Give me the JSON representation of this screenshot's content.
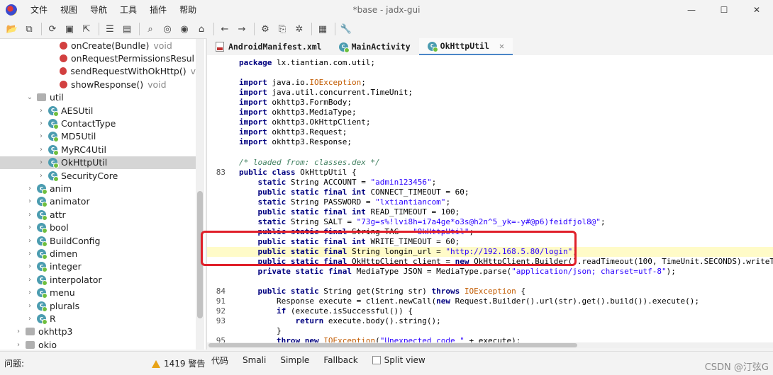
{
  "window": {
    "title": "*base - jadx-gui",
    "minimize": "—",
    "maximize": "☐",
    "close": "✕"
  },
  "menu": [
    "文件",
    "视图",
    "导航",
    "工具",
    "插件",
    "帮助"
  ],
  "toolbar_icons": [
    "open-icon",
    "add-files-icon",
    "sync-icon",
    "save-icon",
    "export-icon",
    "flatten-icon",
    "package-icon",
    "search-icon",
    "find-class-icon",
    "find-usage-icon",
    "home-icon",
    "back-icon",
    "forward-icon",
    "deobfuscation-icon",
    "decompile-icon",
    "debug-icon",
    "log-icon",
    "settings-icon"
  ],
  "tree": {
    "rows": [
      {
        "kind": "method",
        "indent": 84,
        "label": "onCreate(Bundle)",
        "type": "void"
      },
      {
        "kind": "method",
        "indent": 84,
        "label": "onRequestPermissionsResul",
        "type": ""
      },
      {
        "kind": "method",
        "indent": 84,
        "label": "sendRequestWithOkHttp()",
        "type": "v"
      },
      {
        "kind": "method",
        "indent": 84,
        "label": "showResponse()",
        "type": "void"
      },
      {
        "kind": "package",
        "indent": 36,
        "label": "util",
        "twisty": "⌄"
      },
      {
        "kind": "class",
        "indent": 52,
        "label": "AESUtil",
        "twisty": "›"
      },
      {
        "kind": "class",
        "indent": 52,
        "label": "ContactType",
        "twisty": "›"
      },
      {
        "kind": "class",
        "indent": 52,
        "label": "MD5Util",
        "twisty": "›"
      },
      {
        "kind": "class",
        "indent": 52,
        "label": "MyRC4Util",
        "twisty": "›"
      },
      {
        "kind": "class",
        "indent": 52,
        "label": "OkHttpUtil",
        "twisty": "›",
        "selected": true
      },
      {
        "kind": "class",
        "indent": 52,
        "label": "SecurityCore",
        "twisty": "›"
      },
      {
        "kind": "class",
        "indent": 36,
        "label": "anim",
        "twisty": "›"
      },
      {
        "kind": "class",
        "indent": 36,
        "label": "animator",
        "twisty": "›"
      },
      {
        "kind": "class",
        "indent": 36,
        "label": "attr",
        "twisty": "›"
      },
      {
        "kind": "class",
        "indent": 36,
        "label": "bool",
        "twisty": "›"
      },
      {
        "kind": "class",
        "indent": 36,
        "label": "BuildConfig",
        "twisty": "›"
      },
      {
        "kind": "class",
        "indent": 36,
        "label": "dimen",
        "twisty": "›"
      },
      {
        "kind": "class",
        "indent": 36,
        "label": "integer",
        "twisty": "›"
      },
      {
        "kind": "class",
        "indent": 36,
        "label": "interpolator",
        "twisty": "›"
      },
      {
        "kind": "class",
        "indent": 36,
        "label": "menu",
        "twisty": "›"
      },
      {
        "kind": "class",
        "indent": 36,
        "label": "plurals",
        "twisty": "›"
      },
      {
        "kind": "class",
        "indent": 36,
        "label": "R",
        "twisty": "›"
      },
      {
        "kind": "package",
        "indent": 20,
        "label": "okhttp3",
        "twisty": "›"
      },
      {
        "kind": "package",
        "indent": 20,
        "label": "okio",
        "twisty": "›"
      }
    ]
  },
  "tabs": [
    {
      "label": "AndroidManifest.xml",
      "icon": "xml-file-icon",
      "active": false
    },
    {
      "label": "MainActivity",
      "icon": "class-icon",
      "active": false
    },
    {
      "label": "OkHttpUtil",
      "icon": "class-icon",
      "active": true,
      "close": "✕"
    }
  ],
  "code": [
    {
      "ln": "",
      "html": "<span class='kw'>package</span> lx.tiantian.com.util;"
    },
    {
      "ln": "",
      "html": ""
    },
    {
      "ln": "",
      "html": "<span class='kw'>import</span> java.io.<span class='exc'>IOException</span>;"
    },
    {
      "ln": "",
      "html": "<span class='kw'>import</span> java.util.concurrent.TimeUnit;"
    },
    {
      "ln": "",
      "html": "<span class='kw'>import</span> okhttp3.FormBody;"
    },
    {
      "ln": "",
      "html": "<span class='kw'>import</span> okhttp3.MediaType;"
    },
    {
      "ln": "",
      "html": "<span class='kw'>import</span> okhttp3.OkHttpClient;"
    },
    {
      "ln": "",
      "html": "<span class='kw'>import</span> okhttp3.Request;"
    },
    {
      "ln": "",
      "html": "<span class='kw'>import</span> okhttp3.Response;"
    },
    {
      "ln": "",
      "html": ""
    },
    {
      "ln": "",
      "html": "<span class='cmt'>/* loaded from: classes.dex */</span>"
    },
    {
      "ln": "83",
      "html": "<span class='kw'>public class</span> OkHttpUtil {"
    },
    {
      "ln": "",
      "html": "    <span class='kw'>static</span> String ACCOUNT = <span class='str'>\"admin123456\"</span>;"
    },
    {
      "ln": "",
      "html": "    <span class='kw'>public static final int</span> CONNECT_TIMEOUT = 60;"
    },
    {
      "ln": "",
      "html": "    <span class='kw'>static</span> String PASSWORD = <span class='str'>\"lxtiantiancom\"</span>;"
    },
    {
      "ln": "",
      "html": "    <span class='kw'>public static final int</span> READ_TIMEOUT = 100;"
    },
    {
      "ln": "",
      "html": "    <span class='kw'>static</span> String SALT = <span class='str'>\"73g=s%!lvi8h=i7a4ge*o3s@h2n^5_yk=-y#@p6)feidfjol8@\"</span>;"
    },
    {
      "ln": "",
      "html": "    <span class='kw'>public static final</span> String TAG = <span class='str'>\"OkHttpUtil\"</span>;"
    },
    {
      "ln": "",
      "html": "    <span class='kw'>public static final int</span> WRITE_TIMEOUT = 60;"
    },
    {
      "ln": "",
      "html": "    <span class='kw'>public static final</span> String longin_url = <span class='str'>\"http://192.168.5.80/login\"</span>;",
      "hl": true
    },
    {
      "ln": "",
      "html": "    <span class='kw'>public static final</span> OkHttpClient client = <span class='kw'>new</span> OkHttpClient.Builder().readTimeout(100, TimeUnit.SECONDS).writeTimeout("
    },
    {
      "ln": "",
      "html": "    <span class='kw'>private static final</span> MediaType JSON = MediaType.parse(<span class='str'>\"application/json; charset=utf-8\"</span>);"
    },
    {
      "ln": "",
      "html": ""
    },
    {
      "ln": "84",
      "html": "    <span class='kw'>public static</span> String get(String str) <span class='kw'>throws</span> <span class='exc'>IOException</span> {"
    },
    {
      "ln": "91",
      "html": "        Response execute = client.newCall(<span class='kw'>new</span> Request.Builder().url(str).get().build()).execute();"
    },
    {
      "ln": "92",
      "html": "        <span class='kw'>if</span> (execute.isSuccessful()) {"
    },
    {
      "ln": "93",
      "html": "            <span class='kw'>return</span> execute.body().string();"
    },
    {
      "ln": "",
      "html": "        }"
    },
    {
      "ln": "95",
      "html": "        <span class='kw'>throw new</span> <span class='exc'>IOException</span>(<span class='str'>\"Unexpected code \"</span> + execute);"
    }
  ],
  "status": {
    "left": "问题:",
    "warnings": "1419 警告"
  },
  "view_tabs": [
    "代码",
    "Smali",
    "Simple",
    "Fallback"
  ],
  "split_view": "Split view",
  "watermark": "CSDN @汀弦G",
  "colors": {
    "accent": "#4a86c8",
    "highlight_box": "#e0202a",
    "line_highlight": "#fffbc8"
  }
}
